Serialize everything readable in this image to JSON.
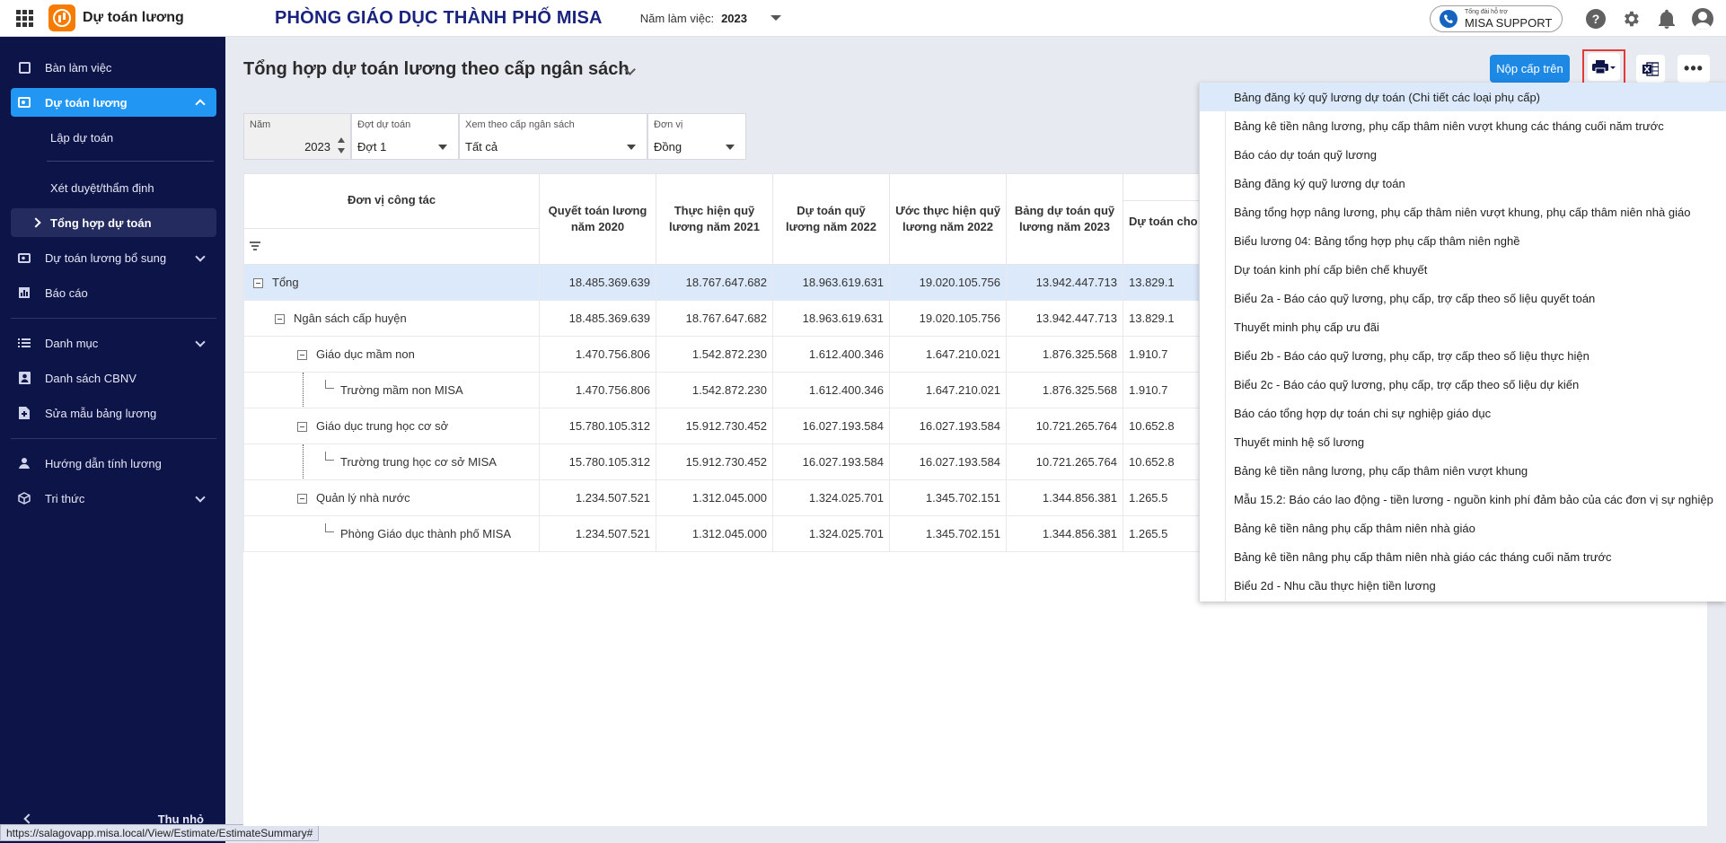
{
  "app": {
    "name": "Dự toán lương",
    "organization": "PHÒNG GIÁO DỤC THÀNH PHỐ MISA",
    "year_label": "Năm làm việc:",
    "year_value": "2023",
    "support_small": "Tổng đài hỗ trợ",
    "support_big": "MISA SUPPORT"
  },
  "sidebar": {
    "items": [
      {
        "label": "Bàn làm việc"
      },
      {
        "label": "Dự toán lương"
      },
      {
        "label": "Lập dự toán"
      },
      {
        "label": "Xét duyệt/thẩm định"
      },
      {
        "label": "Tổng hợp dự toán"
      },
      {
        "label": "Dự toán lương bổ sung"
      },
      {
        "label": "Báo cáo"
      },
      {
        "label": "Danh mục"
      },
      {
        "label": "Danh sách CBNV"
      },
      {
        "label": "Sửa mẫu bảng lương"
      },
      {
        "label": "Hướng dẫn tính lương"
      },
      {
        "label": "Tri thức"
      }
    ],
    "collapse_label": "Thu nhỏ"
  },
  "status_url": "https://salagovapp.misa.local/View/Estimate/EstimateSummary#",
  "page": {
    "title": "Tổng hợp dự toán lương theo cấp ngân sách",
    "submit_button": "Nộp cấp trên"
  },
  "filters": {
    "year": {
      "label": "Năm",
      "value": "2023"
    },
    "batch": {
      "label": "Đợt dự toán",
      "value": "Đợt 1"
    },
    "budget_level": {
      "label": "Xem theo cấp ngân sách",
      "value": "Tất cả"
    },
    "unit": {
      "label": "Đơn vị",
      "value": "Đồng"
    }
  },
  "table": {
    "headers": {
      "unit": "Đơn vị công tác",
      "c1": "Quyết toán lương năm 2020",
      "c2": "Thực hiện quỹ lương năm 2021",
      "c3": "Dự toán quỹ lương năm 2022",
      "c4": "Ước thực hiện quỹ lương năm 2022",
      "c5": "Bảng dự toán quỹ lương năm 2023",
      "c6": "Dự toán cho nhân viên hiệ"
    },
    "rows": [
      {
        "name": "Tổng",
        "c1": "18.485.369.639",
        "c2": "18.767.647.682",
        "c3": "18.963.619.631",
        "c4": "19.020.105.756",
        "c5": "13.942.447.713",
        "c6": "13.829.1"
      },
      {
        "name": "Ngân sách cấp huyện",
        "c1": "18.485.369.639",
        "c2": "18.767.647.682",
        "c3": "18.963.619.631",
        "c4": "19.020.105.756",
        "c5": "13.942.447.713",
        "c6": "13.829.1"
      },
      {
        "name": "Giáo dục mầm non",
        "c1": "1.470.756.806",
        "c2": "1.542.872.230",
        "c3": "1.612.400.346",
        "c4": "1.647.210.021",
        "c5": "1.876.325.568",
        "c6": "1.910.7"
      },
      {
        "name": "Trường mầm non MISA",
        "c1": "1.470.756.806",
        "c2": "1.542.872.230",
        "c3": "1.612.400.346",
        "c4": "1.647.210.021",
        "c5": "1.876.325.568",
        "c6": "1.910.7"
      },
      {
        "name": "Giáo dục trung học cơ sở",
        "c1": "15.780.105.312",
        "c2": "15.912.730.452",
        "c3": "16.027.193.584",
        "c4": "16.027.193.584",
        "c5": "10.721.265.764",
        "c6": "10.652.8"
      },
      {
        "name": "Trường trung học cơ sở MISA",
        "c1": "15.780.105.312",
        "c2": "15.912.730.452",
        "c3": "16.027.193.584",
        "c4": "16.027.193.584",
        "c5": "10.721.265.764",
        "c6": "10.652.8"
      },
      {
        "name": "Quản lý nhà nước",
        "c1": "1.234.507.521",
        "c2": "1.312.045.000",
        "c3": "1.324.025.701",
        "c4": "1.345.702.151",
        "c5": "1.344.856.381",
        "c6": "1.265.5"
      },
      {
        "name": "Phòng Giáo dục thành phố MISA",
        "c1": "1.234.507.521",
        "c2": "1.312.045.000",
        "c3": "1.324.025.701",
        "c4": "1.345.702.151",
        "c5": "1.344.856.381",
        "c6": "1.265.5"
      }
    ]
  },
  "report_menu": {
    "items": [
      "Bảng đăng ký quỹ lương dự toán (Chi tiết các loại phụ cấp)",
      "Bảng kê tiền nâng lương, phụ cấp thâm niên vượt khung các tháng cuối năm trước",
      "Báo cáo dự toán quỹ lương",
      "Bảng đăng ký quỹ lương dự toán",
      "Bảng tổng hợp nâng lương, phụ cấp thâm niên vượt khung, phụ cấp thâm niên nhà giáo",
      "Biểu lương 04: Bảng tổng hợp phụ cấp thâm niên nghề",
      "Dự toán kinh phí cấp biên chế khuyết",
      "Biểu 2a - Báo cáo quỹ lương, phụ cấp, trợ cấp theo số liệu quyết toán",
      "Thuyết minh phụ cấp ưu đãi",
      "Biểu 2b - Báo cáo quỹ lương, phụ cấp, trợ cấp theo số liệu thực hiện",
      "Biểu 2c - Báo cáo quỹ lương, phụ cấp, trợ cấp theo số liệu dự kiến",
      "Báo cáo tổng hợp dự toán chi sự nghiệp giáo dục",
      "Thuyết minh hệ số lương",
      "Bảng kê tiền nâng lương, phụ cấp thâm niên vượt khung",
      "Mẫu 15.2: Báo cáo lao động - tiền lương - nguồn kinh phí đảm bảo của các đơn vị sự nghiệp",
      "Bảng kê tiền nâng phụ cấp thâm niên nhà giáo",
      "Bảng kê tiền nâng phụ cấp thâm niên nhà giáo các tháng cuối năm trước",
      "Biểu 2d - Nhu cầu thực hiện tiền lương"
    ]
  },
  "colors": {
    "sidebar_bg": "#0d1448",
    "accent": "#2196f3",
    "primary_button": "#1e88e5",
    "highlight_row": "#dbe9fb",
    "print_outline": "#e53935"
  }
}
